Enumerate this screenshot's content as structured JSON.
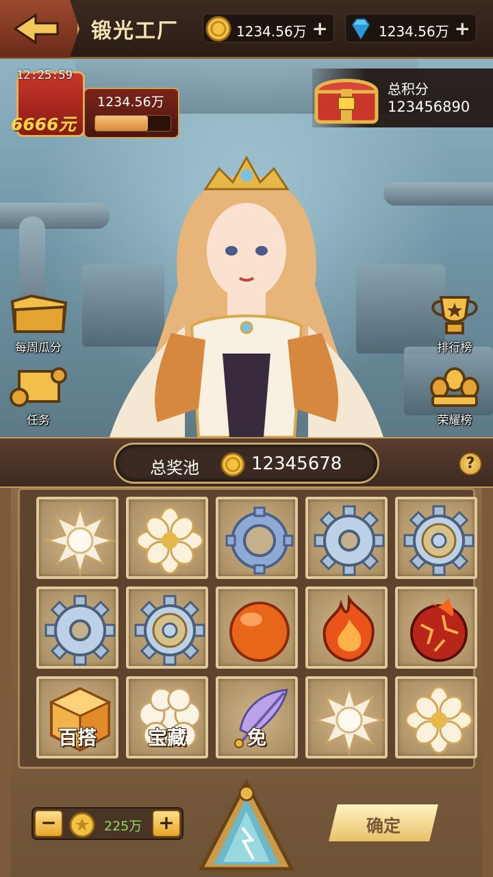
{
  "header": {
    "title": "锻光工厂",
    "gold_amount": "1234.56万",
    "gem_amount": "1234.56万",
    "plus_symbol": "+"
  },
  "event": {
    "countdown": "12:25:59",
    "reward_money": "6666元",
    "progress_value": "1234.56万",
    "progress_fraction": 0.7
  },
  "score": {
    "label": "总积分",
    "value": "123456890"
  },
  "side_buttons": {
    "weekly_share": "每周瓜分",
    "tasks": "任务",
    "ranking": "排行榜",
    "honor_board": "荣耀榜"
  },
  "pool": {
    "label": "总奖池",
    "value": "12345678",
    "help_symbol": "?"
  },
  "grid": {
    "items": [
      {
        "icon": "white-sun-gem-icon",
        "tag": ""
      },
      {
        "icon": "white-lotus-gem-icon",
        "tag": ""
      },
      {
        "icon": "blue-ring-gear-icon",
        "tag": ""
      },
      {
        "icon": "silver-gear-icon",
        "tag": ""
      },
      {
        "icon": "ornate-silver-gear-icon",
        "tag": ""
      },
      {
        "icon": "silver-gear-icon",
        "tag": ""
      },
      {
        "icon": "ornate-silver-gear-icon",
        "tag": ""
      },
      {
        "icon": "orange-orb-icon",
        "tag": ""
      },
      {
        "icon": "fire-crystal-icon",
        "tag": ""
      },
      {
        "icon": "lava-stone-icon",
        "tag": ""
      },
      {
        "icon": "golden-cube-icon",
        "tag": "百搭"
      },
      {
        "icon": "pearl-cluster-icon",
        "tag": "宝藏"
      },
      {
        "icon": "purple-feather-icon",
        "tag": "免"
      },
      {
        "icon": "white-sun-gem-icon",
        "tag": ""
      },
      {
        "icon": "white-lotus-gem-icon",
        "tag": ""
      }
    ]
  },
  "controls": {
    "minus_symbol": "−",
    "plus_symbol": "+",
    "bet_amount": "225万",
    "confirm_label": "确定"
  },
  "colors": {
    "accent_gold": "#d9a84a",
    "panel_brown": "#5e442e",
    "bet_green": "#8fdc6a"
  }
}
